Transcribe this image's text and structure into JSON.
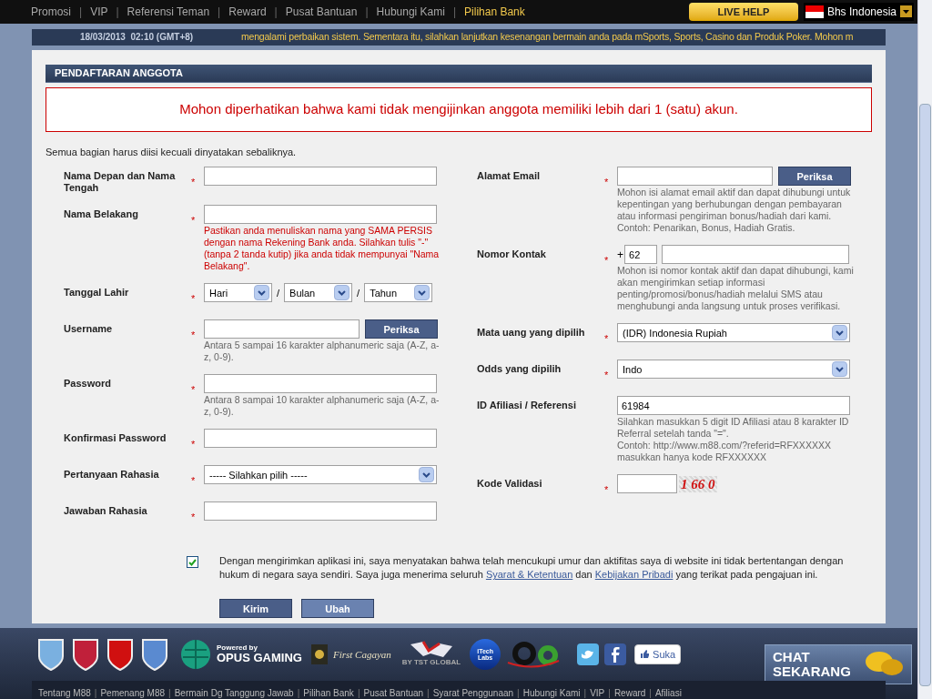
{
  "nav": {
    "items": [
      {
        "label": "Promosi",
        "selected": false
      },
      {
        "label": "VIP",
        "selected": false
      },
      {
        "label": "Referensi Teman",
        "selected": false
      },
      {
        "label": "Reward",
        "selected": false
      },
      {
        "label": "Pusat Bantuan",
        "selected": false
      },
      {
        "label": "Hubungi Kami",
        "selected": false
      },
      {
        "label": "Pilihan Bank",
        "selected": true
      }
    ],
    "separator": "|",
    "live_help": "LIVE HELP",
    "language": "Bhs Indonesia"
  },
  "ticker": {
    "datetime": "18/03/2013  02:10 (GMT+8)",
    "message": "mengalami perbaikan sistem. Sementara itu, silahkan lanjutkan kesenangan bermain anda pada mSports, Sports, Casino dan Produk Poker. Mohon m"
  },
  "section_title": "PENDAFTARAN ANGGOTA",
  "notice": "Mohon diperhatikan bahwa kami tidak mengijinkan anggota memiliki lebih dari 1 (satu) akun.",
  "intro": "Semua bagian harus diisi kecuali dinyatakan sebaliknya.",
  "left_fields": [
    {
      "kind": "text",
      "label": "Nama Depan dan Nama Tengah",
      "required_mark": "*"
    },
    {
      "kind": "text",
      "label": "Nama Belakang",
      "required_mark": "*",
      "hint": "Pastikan anda menuliskan nama yang SAMA PERSIS dengan nama Rekening Bank anda. Silahkan tulis \"-\" (tanpa 2 tanda kutip) jika anda tidak mempunyai \"Nama Belakang\".",
      "hint_warning": true
    },
    {
      "kind": "date",
      "label": "Tanggal Lahir",
      "required_mark": "*",
      "selects": [
        "Hari",
        "Bulan",
        "Tahun"
      ],
      "separator": "/"
    },
    {
      "kind": "check",
      "label": "Username",
      "required_mark": "*",
      "button": "Periksa",
      "hint": "Antara 5 sampai 16 karakter alphanumeric saja (A-Z, a-z, 0-9).",
      "hint_warning": false
    },
    {
      "kind": "text",
      "label": "Password",
      "required_mark": "*",
      "hint": "Antara 8 sampai 10 karakter alphanumeric saja (A-Z, a-z, 0-9).",
      "hint_warning": false
    },
    {
      "kind": "text",
      "label": "Konfirmasi Password",
      "required_mark": "*"
    },
    {
      "kind": "select",
      "label": "Pertanyaan Rahasia",
      "required_mark": "*",
      "value": "----- Silahkan pilih -----"
    },
    {
      "kind": "text",
      "label": "Jawaban Rahasia",
      "required_mark": "*"
    }
  ],
  "right_fields": [
    {
      "kind": "check",
      "label": "Alamat Email",
      "required_mark": "*",
      "button": "Periksa",
      "hint": "Mohon isi alamat email aktif dan dapat dihubungi untuk kepentingan yang berhubungan dengan pembayaran atau informasi pengiriman bonus/hadiah dari kami. Contoh: Penarikan, Bonus, Hadiah Gratis.",
      "hint_warning": false
    },
    {
      "kind": "phone",
      "label": "Nomor Kontak",
      "required_mark": "*",
      "prefix": "+",
      "code": "62",
      "hint": "Mohon isi nomor kontak aktif dan dapat dihubungi, kami akan mengirimkan setiap informasi penting/promosi/bonus/hadiah melalui SMS atau menghubungi anda langsung untuk proses verifikasi.",
      "hint_warning": false
    },
    {
      "kind": "select",
      "label": "Mata uang yang dipilih",
      "required_mark": "*",
      "value": "(IDR) Indonesia Rupiah"
    },
    {
      "kind": "select",
      "label": "Odds yang dipilih",
      "required_mark": "*",
      "value": "Indo"
    },
    {
      "kind": "text",
      "label": "ID Afiliasi / Referensi",
      "value": "61984",
      "hint": "Silahkan masukkan 5 digit ID Afiliasi atau 8 karakter ID Referral setelah tanda \"=\".\nContoh: http://www.m88.com/?referid=RFXXXXXX\nmasukkan hanya kode RFXXXXXX",
      "hint_warning": false
    },
    {
      "kind": "captcha",
      "label": "Kode Validasi",
      "required_mark": "*",
      "code": "1 66 0"
    }
  ],
  "agreement": {
    "checked": true,
    "text_before": "Dengan mengirimkan aplikasi ini, saya menyatakan bahwa telah mencukupi umur dan aktifitas saya di website ini tidak bertentangan dengan hukum di negara saya sendiri. Saya juga menerima seluruh",
    "link1": "Syarat & Ketentuan",
    "text_middle": "dan",
    "link2": "Kebijakan Pribadi",
    "text_after": "yang terikat pada pengajuan ini."
  },
  "buttons": [
    {
      "label": "Kirim",
      "kind": "primary"
    },
    {
      "label": "Ubah",
      "kind": "secondary"
    }
  ],
  "footer": {
    "powered_by": "Powered by",
    "opus": "OPUS GAMING",
    "first_cagayan": "First Cagayan",
    "tst": "BY TST GLOBAL",
    "itech": "iTech Labs",
    "like": "Suka",
    "chat": [
      "CHAT",
      "SEKARANG"
    ],
    "separator": "|",
    "links": [
      "Tentang M88",
      "Pemenang M88",
      "Bermain Dg Tanggung Jawab",
      "Pilihan Bank",
      "Pusat Bantuan",
      "Syarat Penggunaan",
      "Hubungi Kami",
      "VIP",
      "Reward",
      "Afiliasi"
    ]
  }
}
